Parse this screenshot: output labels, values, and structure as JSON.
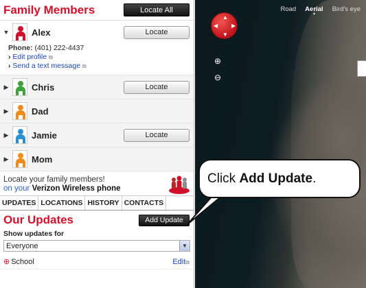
{
  "family": {
    "title": "Family Members",
    "locate_all": "Locate All",
    "members": [
      {
        "name": "Alex",
        "color": "#d0112b",
        "expanded": true,
        "locate": "Locate"
      },
      {
        "name": "Chris",
        "color": "#3da23b",
        "expanded": false,
        "locate": "Locate"
      },
      {
        "name": "Dad",
        "color": "#f08c1e",
        "expanded": false
      },
      {
        "name": "Jamie",
        "color": "#2a8fd0",
        "expanded": false,
        "locate": "Locate"
      },
      {
        "name": "Mom",
        "color": "#f08c1e",
        "expanded": false
      }
    ],
    "alex_details": {
      "phone_label": "Phone:",
      "phone": "(401) 222-4437",
      "edit_profile": "Edit profile",
      "send_text": "Send a text message"
    }
  },
  "promo": {
    "line1": "Locate your family members!",
    "line2_prefix": "on your",
    "line2_brand": "Verizon Wireless phone"
  },
  "tabs": [
    "UPDATES",
    "LOCATIONS",
    "HISTORY",
    "CONTACTS"
  ],
  "updates": {
    "title": "Our Updates",
    "add_update": "Add Update",
    "show_label": "Show updates for",
    "filter_value": "Everyone",
    "items": [
      {
        "name": "School",
        "edit": "Edit"
      }
    ]
  },
  "map": {
    "views": [
      "Road",
      "Aerial",
      "Bird's eye"
    ],
    "active_view": "Aerial"
  },
  "callout": {
    "prefix": "Click ",
    "bold": "Add Update",
    "suffix": "."
  },
  "icons": {
    "external": "external-link-icon",
    "pan": "pan-control-icon",
    "zoom_in": "zoom-in-icon",
    "zoom_out": "zoom-out-icon"
  }
}
